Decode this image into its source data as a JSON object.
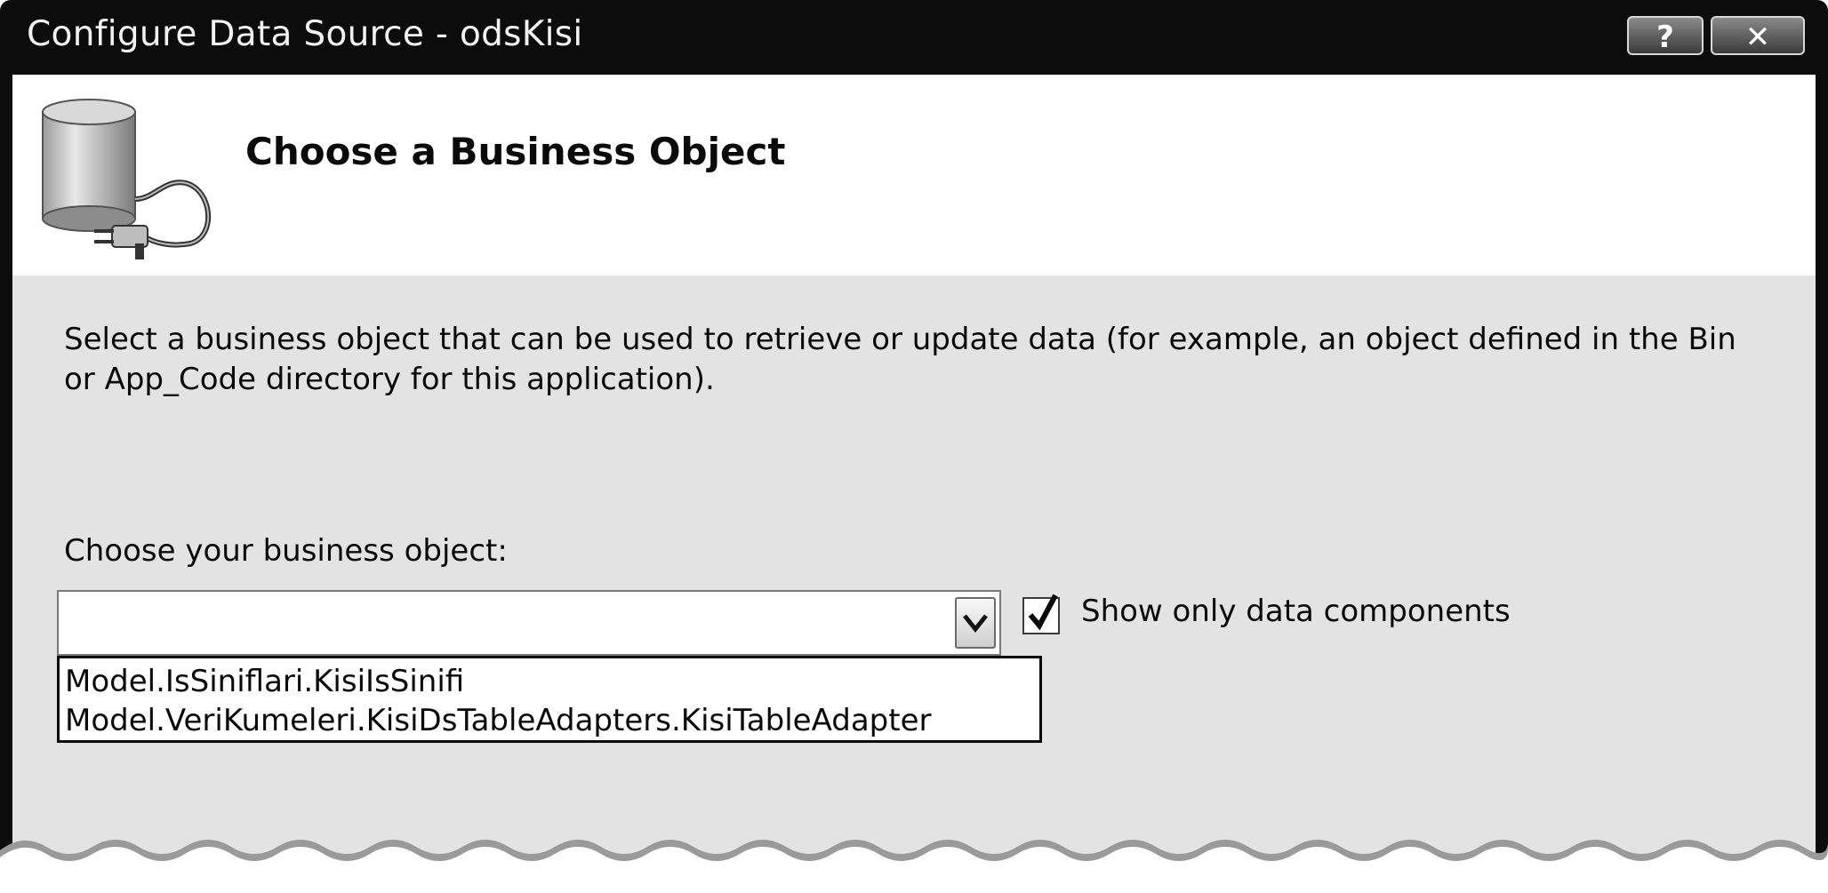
{
  "window": {
    "title": "Configure Data Source - odsKisi",
    "help_label": "?",
    "close_label": "✕"
  },
  "header": {
    "heading": "Choose a Business Object",
    "icon": "database-plug-icon"
  },
  "content": {
    "description": "Select a business object that can be used to retrieve or update data (for example, an object defined in the Bin or App_Code directory for this application).",
    "choose_label": "Choose your business object:",
    "combo_value": "",
    "options": [
      "Model.IsSiniflari.KisiIsSinifi",
      "Model.VeriKumeleri.KisiDsTableAdapters.KisiTableAdapter"
    ],
    "show_only_label": "Show only data components",
    "show_only_checked": true
  },
  "colors": {
    "titlebar": "#0c0c0c",
    "content_bg": "#e3e3e3",
    "header_bg": "#ffffff"
  }
}
